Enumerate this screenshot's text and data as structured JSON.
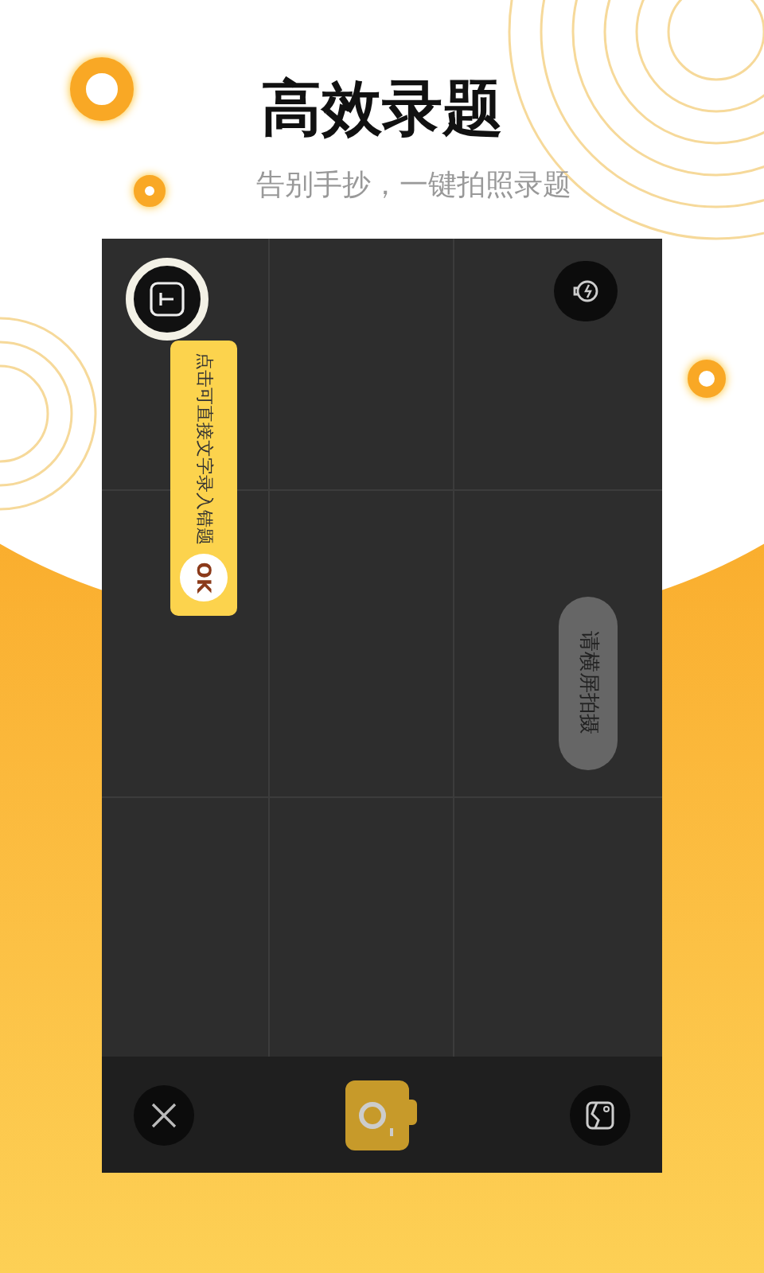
{
  "title": "高效录题",
  "subtitle": "告别手抄，一键拍照录题",
  "camera": {
    "tooltip": {
      "text": "点击可直接文字录入错题",
      "button": "OK"
    },
    "hint": "请横屏拍摄"
  }
}
